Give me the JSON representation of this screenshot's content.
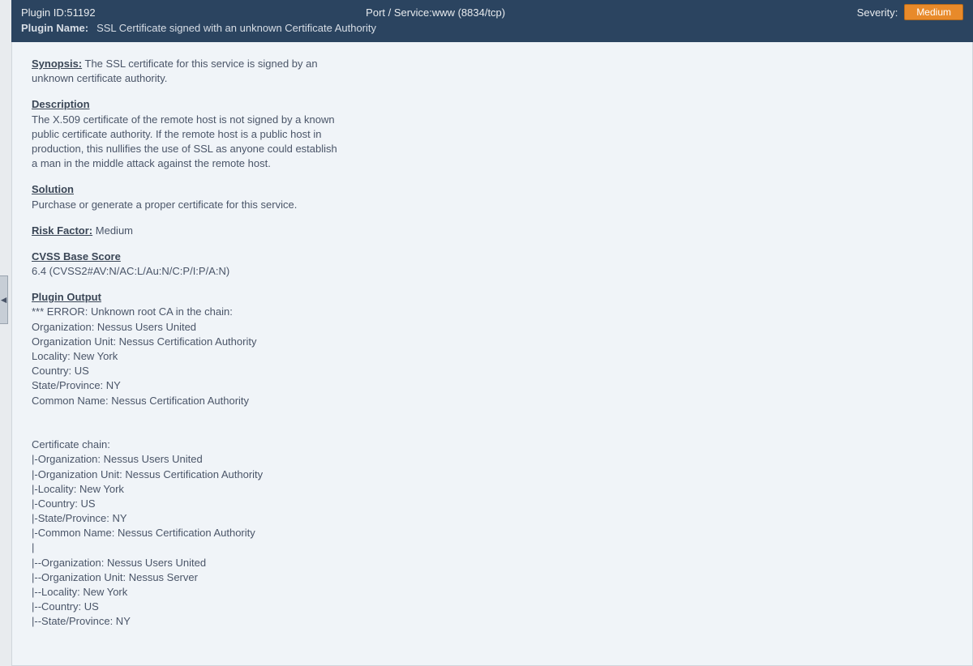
{
  "header": {
    "pluginId": {
      "label": "Plugin ID:",
      "value": "51192"
    },
    "portService": {
      "label": "Port / Service:",
      "value": "www (8834/tcp)"
    },
    "severity": {
      "label": "Severity:",
      "value": "Medium"
    },
    "pluginName": {
      "label": "Plugin Name:",
      "value": "SSL Certificate signed with an unknown Certificate Authority"
    }
  },
  "detail": {
    "synopsis": {
      "label": "Synopsis:",
      "value": "The SSL certificate for this service is signed by an unknown certificate authority."
    },
    "description": {
      "label": "Description",
      "value": "The X.509 certificate of the remote host is not signed by a known public certificate authority.  If the remote host is a public host in production, this nullifies the use of SSL as anyone could establish a man in the middle attack against the remote host."
    },
    "solution": {
      "label": "Solution",
      "value": "Purchase or generate a proper certificate for this service."
    },
    "riskFactor": {
      "label": "Risk Factor:",
      "value": "Medium"
    },
    "cvss": {
      "label": "CVSS Base Score",
      "value": " 6.4 (CVSS2#AV:N/AC:L/Au:N/C:P/I:P/A:N)"
    },
    "pluginOutput": {
      "label": "Plugin Output",
      "value": "*** ERROR: Unknown root CA in the chain:\nOrganization: Nessus Users United\nOrganization Unit: Nessus Certification Authority\nLocality: New York\nCountry: US\nState/Province: NY\nCommon Name: Nessus Certification Authority\n\n\nCertificate chain:\n|-Organization: Nessus Users United\n|-Organization Unit: Nessus Certification Authority\n|-Locality: New York\n|-Country: US\n|-State/Province: NY\n|-Common Name: Nessus Certification Authority\n|\n|--Organization: Nessus Users United\n|--Organization Unit: Nessus Server\n|--Locality: New York\n|--Country: US\n|--State/Province: NY"
    }
  },
  "sideTab": "◄"
}
